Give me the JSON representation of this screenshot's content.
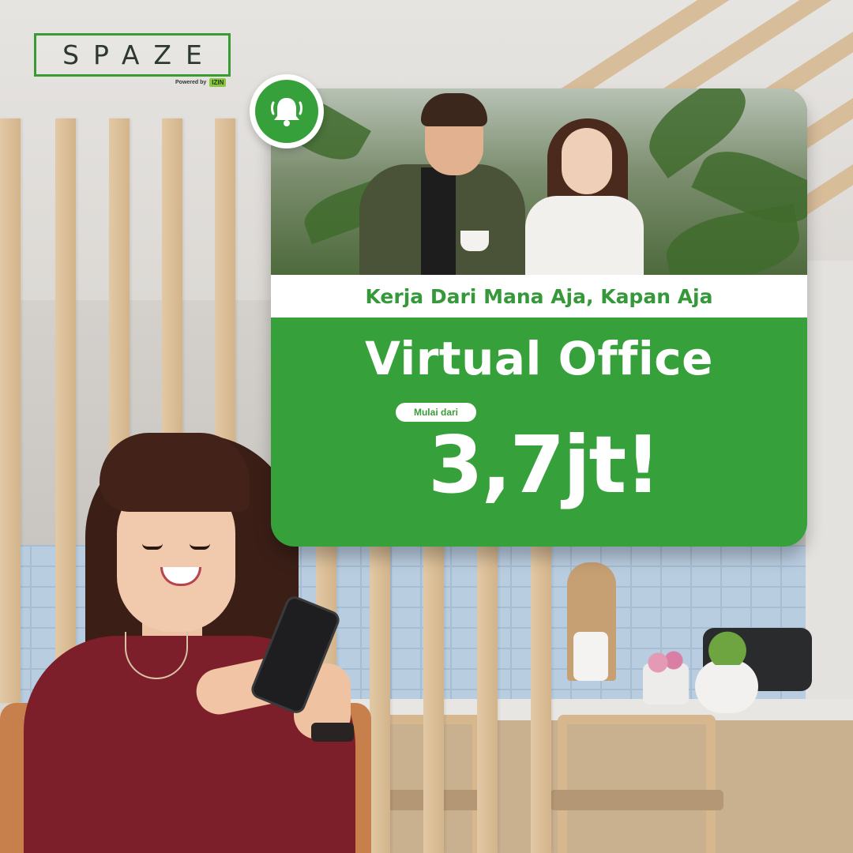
{
  "brand": {
    "logo_text": "SPAZE",
    "powered_by": "Powered by",
    "partner_logo": "IZIN"
  },
  "promo": {
    "icon": "bell-ringing-icon",
    "tagline": "Kerja Dari Mana Aja, Kapan Aja",
    "title": "Virtual Office",
    "price_prefix": "Mulai dari",
    "price": "3,7jt!"
  },
  "colors": {
    "brand_green": "#36a13a",
    "white": "#ffffff",
    "logo_border": "#3a9a34"
  }
}
